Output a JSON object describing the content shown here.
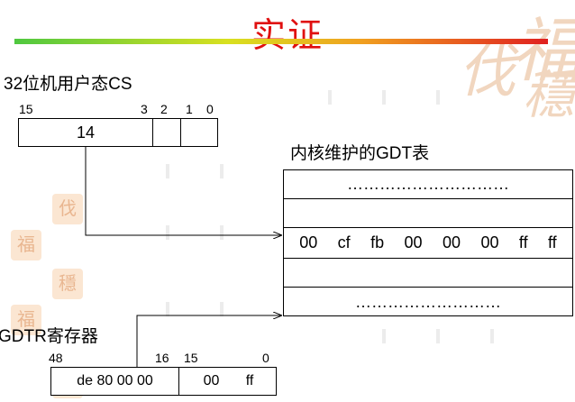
{
  "slide": {
    "title": "实证",
    "cs_label": "32位机用户态CS",
    "cs_bits": [
      "15",
      "3",
      "2",
      "1",
      "0"
    ],
    "cs_value": "14",
    "gdt_label": "内核维护的GDT表",
    "gdt_dots_top": "…………………………",
    "gdt_bytes": [
      "00",
      "cf",
      "fb",
      "00",
      "00",
      "00",
      "ff",
      "ff"
    ],
    "gdt_dots_bottom": "………………………",
    "gdtr_label": "GDTR寄存器",
    "gdtr_bits": [
      "48",
      "16",
      "15",
      "0"
    ],
    "gdtr_high": "de 80 00 00",
    "gdtr_low_a": "00",
    "gdtr_low_b": "ff"
  },
  "colors": {
    "title": "#e01010",
    "bar_start": "#4fc840",
    "bar_end": "#e02020",
    "decoration": "#f1d6bf"
  }
}
